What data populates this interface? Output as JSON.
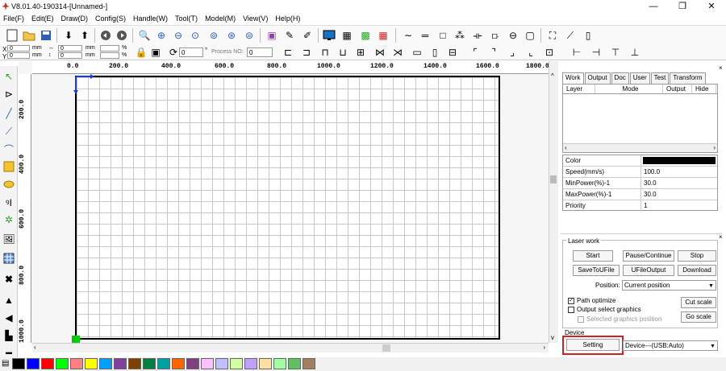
{
  "window": {
    "title": "V8.01.40-190314-[Unnamed-]",
    "min_icon": "minimize-icon",
    "max_icon": "maximize-icon",
    "close_icon": "close-icon"
  },
  "menu": [
    "File(F)",
    "Edit(E)",
    "Draw(D)",
    "Config(S)",
    "Handle(W)",
    "Tool(T)",
    "Model(M)",
    "View(V)",
    "Help(H)"
  ],
  "toolbar2": {
    "x_label": "X",
    "y_label": "Y",
    "x_value": "0",
    "y_value": "0",
    "unit1": "mm",
    "unit2": "mm",
    "w_value": "0",
    "h_value": "0",
    "unit3": "mm",
    "unit4": "mm",
    "pct1": "%",
    "pct2": "%",
    "angle_value": "0",
    "process_no_label": "Process NO:",
    "process_no_value": "0"
  },
  "rulers": {
    "h": [
      "0.0",
      "200.0",
      "400.0",
      "600.0",
      "800.0",
      "1000.0",
      "1200.0",
      "1400.0",
      "1600.0",
      "1800.0"
    ],
    "v": [
      "200.0",
      "400.0",
      "600.0",
      "800.0",
      "1000.0"
    ]
  },
  "tabs": [
    "Work",
    "Output",
    "Doc",
    "User",
    "Test",
    "Transform"
  ],
  "layers": {
    "headers": [
      "Layer",
      "Mode",
      "Output",
      "Hide"
    ]
  },
  "props": [
    {
      "k": "Color",
      "v": ""
    },
    {
      "k": "Speed(mm/s)",
      "v": "100.0"
    },
    {
      "k": "MinPower(%)-1",
      "v": "30.0"
    },
    {
      "k": "MaxPower(%)-1",
      "v": "30.0"
    },
    {
      "k": "Priority",
      "v": "1"
    }
  ],
  "laser_work": {
    "title": "Laser work",
    "start": "Start",
    "pause": "Pause/Continue",
    "stop": "Stop",
    "save_u": "SaveToUFile",
    "ufile_output": "UFileOutput",
    "download": "Download",
    "position_label": "Position:",
    "position_value": "Current position",
    "path_optimize": "Path optimize",
    "output_select": "Output select graphics",
    "selected_pos": "Selected graphics position",
    "cut_scale": "Cut scale",
    "go_scale": "Go scale"
  },
  "device": {
    "title": "Device",
    "setting": "Setting",
    "device_value": "Device---(USB:Auto)"
  },
  "palette": [
    "#000000",
    "#0000ff",
    "#ff0000",
    "#00ff00",
    "#ff8080",
    "#ffff00",
    "#00a0ff",
    "#8040a0",
    "#804000",
    "#008040",
    "#00a0a0",
    "#ff6600",
    "#804080",
    "#ffc0ff",
    "#c0c0ff",
    "#d0ffa0",
    "#c0a0ff",
    "#ffe0a0",
    "#a0ffa0",
    "#60c060",
    "#a08060"
  ]
}
